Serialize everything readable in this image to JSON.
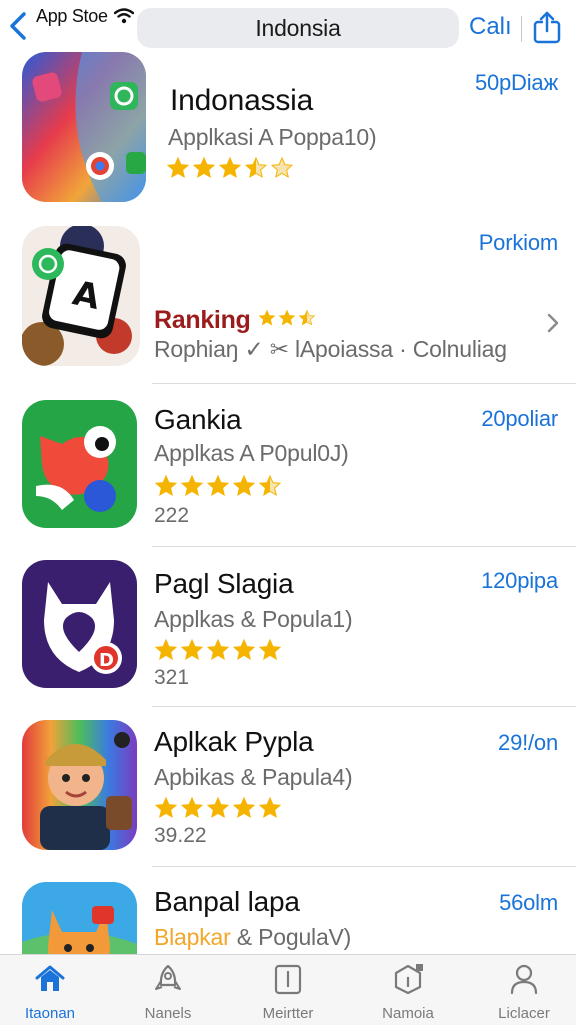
{
  "header": {
    "back_label": "App Stoe",
    "search_text": "Indonsia",
    "call_label": "Calı"
  },
  "apps": [
    {
      "title": "Indonassia",
      "subtitle": "Applkasi  A  Poppa10)",
      "get": "50pDiaж",
      "rating": 3.5
    },
    {
      "title": "",
      "ranking": "Ranking",
      "subtitle": "Rophiaŋ ✓ ✂ lApoiassa · Colnuliag",
      "get": "Porkiom",
      "rating": 2.5
    },
    {
      "title": "Gankia",
      "subtitle": "Applkas  A  P0pul0J)",
      "get": "20poliar",
      "rating": 4.5,
      "count": "222"
    },
    {
      "title": "Pagl Slagia",
      "subtitle": "Applkas  & Popula1)",
      "get": "120pipa",
      "rating": 5,
      "count": "321"
    },
    {
      "title": "Aplkak Pypla",
      "subtitle": "Apbikas  & Papula4)",
      "get": "29!/on",
      "rating": 5,
      "count": "39.22"
    },
    {
      "title": "Banpal lapa",
      "subtitle_highlight": "Blapkar",
      "subtitle": " & PogulaV)",
      "get": "56olm"
    }
  ],
  "tabs": [
    {
      "label": "Itaonan",
      "icon": "home-icon"
    },
    {
      "label": "Nanels",
      "icon": "rocket-icon"
    },
    {
      "label": "Meirtter",
      "icon": "tablet-icon"
    },
    {
      "label": "Namoia",
      "icon": "cube-icon"
    },
    {
      "label": "Liclacer",
      "icon": "person-icon"
    }
  ],
  "colors": {
    "accent": "#1a73d8",
    "star": "#f4b400",
    "ranking": "#9b1c1c"
  }
}
